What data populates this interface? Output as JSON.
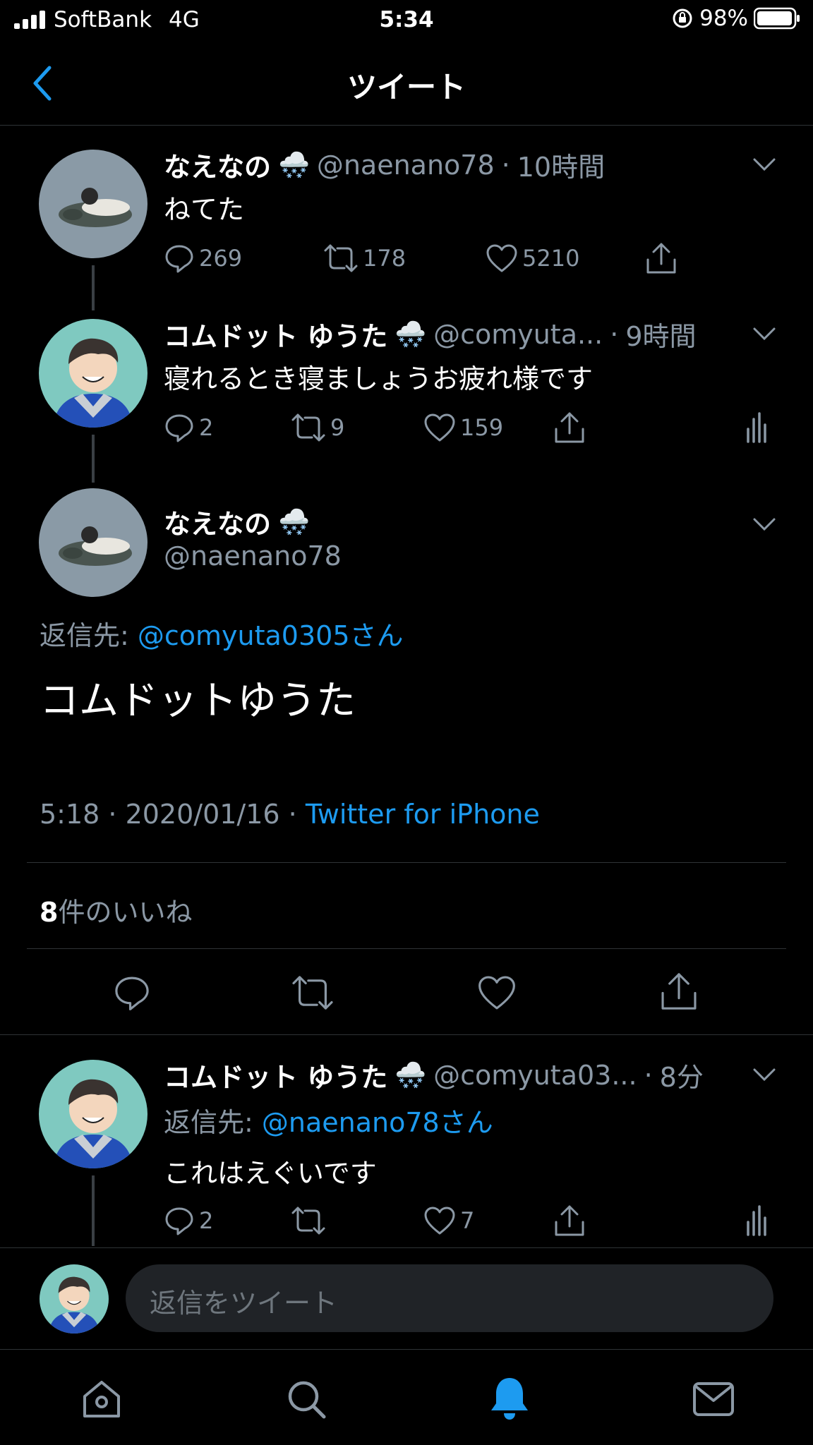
{
  "status_bar": {
    "carrier": "SoftBank",
    "network": "4G",
    "time": "5:34",
    "battery": "98%"
  },
  "header": {
    "title": "ツイート",
    "back_icon": "chevron-left-icon"
  },
  "tweets": [
    {
      "name": "なえなの",
      "handle": "@naenano78",
      "time": "10時間",
      "text": "ねてた",
      "replies": "269",
      "retweets": "178",
      "likes": "5210"
    },
    {
      "name": "コムドット ゆうた",
      "handle": "@comyuta...",
      "time": "9時間",
      "text": "寝れるとき寝ましょうお疲れ様です",
      "replies": "2",
      "retweets": "9",
      "likes": "159"
    }
  ],
  "main_tweet": {
    "name": "なえなの",
    "handle": "@naenano78",
    "reply_prefix": "返信先: ",
    "reply_to": "@comyuta0305さん",
    "text": "コムドットゆうた",
    "timestamp": "5:18 · 2020/01/16 · ",
    "source": "Twitter for iPhone",
    "likes_count": "8",
    "likes_label": "件のいいね"
  },
  "reply_tweet": {
    "name": "コムドット ゆうた",
    "handle": "@comyuta03...",
    "time": "8分",
    "reply_prefix": "返信先: ",
    "reply_to": "@naenano78さん",
    "text": "これはえぐいです",
    "replies": "2",
    "likes": "7"
  },
  "reply_bar": {
    "placeholder": "返信をツイート"
  },
  "tab_bar": [
    "home-icon",
    "search-icon",
    "notifications-icon",
    "messages-icon"
  ],
  "colors": {
    "accent": "#1d9bf0",
    "background": "#000000",
    "secondary_text": "#8b98a5"
  }
}
